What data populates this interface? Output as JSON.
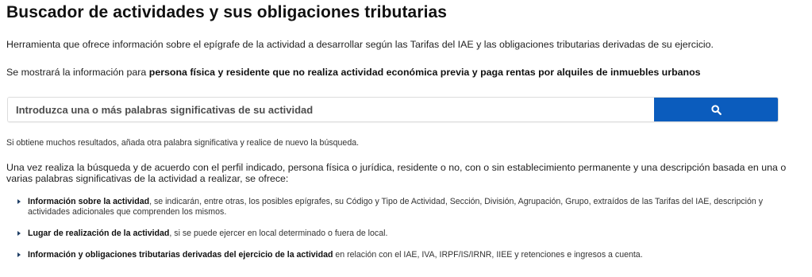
{
  "header": {
    "title": "Buscador de actividades y sus obligaciones tributarias"
  },
  "intro": {
    "text": "Herramienta que ofrece información sobre el epígrafe de la actividad a desarrollar según las Tarifas del IAE y las obligaciones tributarias derivadas de su ejercicio."
  },
  "profile": {
    "prefix": "Se mostrará la información para ",
    "strong": "persona física y residente que no realiza actividad económica previa y paga rentas por alquiles de inmuebles urbanos"
  },
  "search": {
    "placeholder": "Introduzca una o más palabras significativas de su actividad",
    "value": "",
    "button_icon": "search-icon",
    "button_color": "#0b5cbd"
  },
  "hint": {
    "text": "Si obtiene muchos resultados, añada otra palabra significativa y realice de nuevo la búsqueda."
  },
  "description": {
    "text": "Una vez realiza la búsqueda y de acuerdo con el perfil indicado, persona física o jurídica, residente o no, con o sin establecimiento permanente y una descripción basada en una o varias palabras significativas de la actividad a realizar, se ofrece:"
  },
  "bullets": [
    {
      "strong": "Información sobre la actividad",
      "rest": ", se indicarán, entre otras, los posibles epígrafes, su Código y Tipo de Actividad, Sección, División, Agrupación, Grupo, extraídos de las Tarifas del IAE, descripción y actividades adicionales que comprenden los mismos."
    },
    {
      "strong": "Lugar de realización de la actividad",
      "rest": ", si se puede ejercer en local determinado o fuera de local."
    },
    {
      "strong": "Información y obligaciones tributarias derivadas del ejercicio de la actividad",
      "rest": " en relación con el IAE, IVA, IRPF/IS/IRNR, IIEE y retenciones e ingresos a cuenta."
    }
  ]
}
